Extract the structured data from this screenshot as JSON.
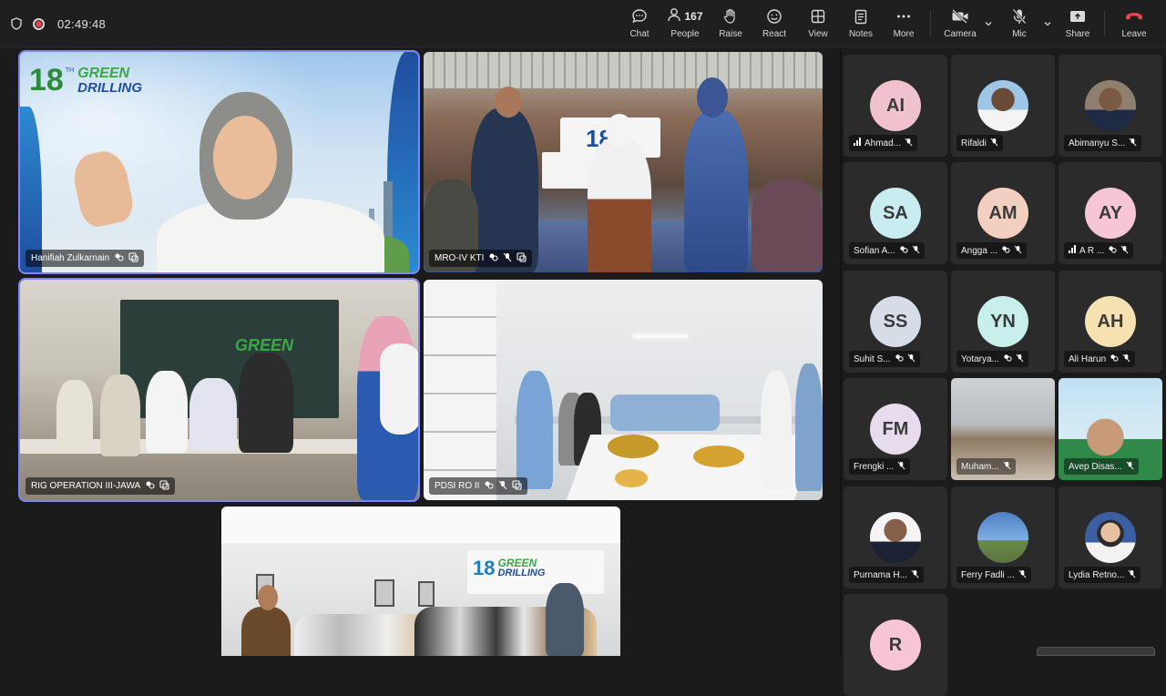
{
  "meeting": {
    "timer": "02:49:48",
    "toolbar": {
      "chat": "Chat",
      "people": "People",
      "people_count": "167",
      "raise": "Raise",
      "react": "React",
      "view": "View",
      "notes": "Notes",
      "more": "More",
      "camera": "Camera",
      "mic": "Mic",
      "share": "Share",
      "leave": "Leave"
    },
    "colors": {
      "leave": "#e0484b",
      "active_border": "#7f85f5",
      "rec": "#e0484b"
    }
  },
  "video_tiles": [
    {
      "name": "Hanifiah Zulkarnain",
      "active": true,
      "logo_number": "18",
      "logo_sup": "TH",
      "logo_line1": "GREEN",
      "logo_line2": "DRILLING"
    },
    {
      "name": "MRO-IV KTI",
      "active": false,
      "banner": "18"
    },
    {
      "name": "RIG OPERATION III-JAWA",
      "active": true,
      "banner": "GREEN"
    },
    {
      "name": "PDSI RO II",
      "active": false
    },
    {
      "name": "",
      "active": false,
      "logo_number": "18",
      "logo_line1": "GREEN",
      "logo_line2": "DRILLING"
    }
  ],
  "participants": [
    {
      "initials": "AI",
      "name": "Ahmad...",
      "avatar_color": "#f0c2ce",
      "signal": true,
      "reactions": false,
      "muted": true
    },
    {
      "initials": "",
      "name": "Rifaldi",
      "photo": "man-white-shirt",
      "signal": false,
      "reactions": false,
      "muted": true
    },
    {
      "initials": "",
      "name": "Abimanyu S...",
      "photo": "man-suit",
      "signal": false,
      "reactions": false,
      "muted": true
    },
    {
      "initials": "SA",
      "name": "Sofian A...",
      "avatar_color": "#c8ecf0",
      "signal": false,
      "reactions": true,
      "muted": true
    },
    {
      "initials": "AM",
      "name": "Angga ...",
      "avatar_color": "#f3cfc0",
      "signal": false,
      "reactions": true,
      "muted": true
    },
    {
      "initials": "AY",
      "name": "A R ...",
      "avatar_color": "#f6c6d6",
      "signal": true,
      "reactions": true,
      "muted": true
    },
    {
      "initials": "SS",
      "name": "Suhit S...",
      "avatar_color": "#d6dde6",
      "signal": false,
      "reactions": true,
      "muted": true
    },
    {
      "initials": "YN",
      "name": "Yotarya...",
      "avatar_color": "#c9efea",
      "signal": false,
      "reactions": true,
      "muted": true
    },
    {
      "initials": "AH",
      "name": "Ali Harun",
      "avatar_color": "#f6e2b0",
      "signal": false,
      "reactions": true,
      "muted": true
    },
    {
      "initials": "FM",
      "name": "Frengki ...",
      "avatar_color": "#e6dced",
      "signal": false,
      "reactions": false,
      "muted": true
    },
    {
      "initials": "",
      "name": "Muham...",
      "photo": "video-room",
      "signal": false,
      "reactions": false,
      "muted": true
    },
    {
      "initials": "",
      "name": "Avep Disas...",
      "photo": "video-man",
      "signal": false,
      "reactions": false,
      "muted": true
    },
    {
      "initials": "",
      "name": "Purnama H...",
      "photo": "man-suit-red",
      "signal": false,
      "reactions": false,
      "muted": true
    },
    {
      "initials": "",
      "name": "Ferry Fadli ...",
      "photo": "tower",
      "signal": false,
      "reactions": false,
      "muted": true
    },
    {
      "initials": "",
      "name": "Lydia Retno...",
      "photo": "woman",
      "signal": false,
      "reactions": false,
      "muted": true
    },
    {
      "initials": "R",
      "name": "",
      "avatar_color": "#f6c6d6",
      "signal": false,
      "reactions": false,
      "muted": false
    }
  ]
}
